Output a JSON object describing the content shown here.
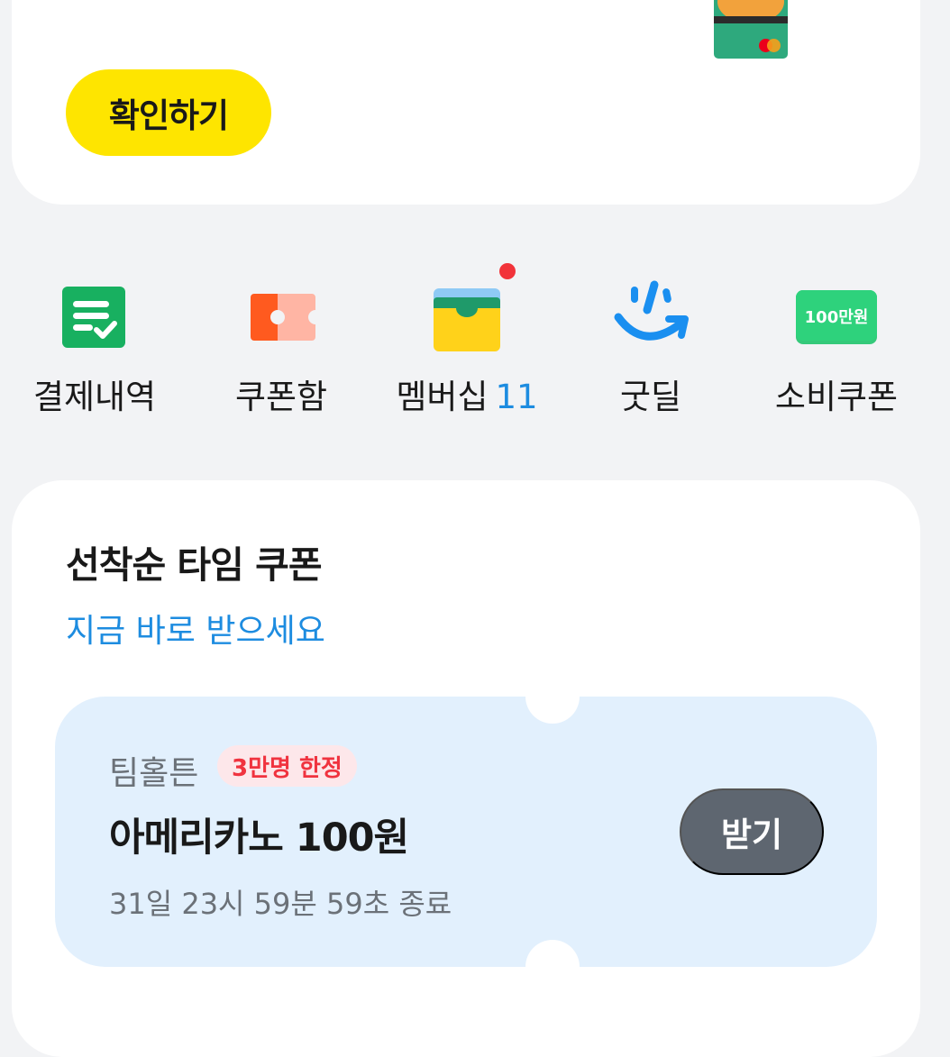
{
  "top_card": {
    "confirm_label": "확인하기"
  },
  "quick_menu": {
    "items": [
      {
        "label": "결제내역",
        "icon": "receipt-check-icon"
      },
      {
        "label": "쿠폰함",
        "icon": "ticket-icon"
      },
      {
        "label": "멤버십",
        "count": "11",
        "icon": "wallet-icon",
        "has_new_dot": true
      },
      {
        "label": "굿딜",
        "icon": "smile-arrow-icon"
      },
      {
        "label": "소비쿠폰",
        "icon": "voucher-100man-icon",
        "icon_text": "100만원"
      }
    ]
  },
  "coupon_section": {
    "title": "선착순 타임 쿠폰",
    "subtitle": "지금 바로 받으세요",
    "coupon": {
      "brand": "팀홀튼",
      "limit_badge": "3만명 한정",
      "title": "아메리카노 100원",
      "end_time": "31일 23시 59분 59초 종료",
      "get_label": "받기"
    }
  },
  "colors": {
    "background": "#f2f3f5",
    "accent_yellow": "#fee500",
    "accent_blue": "#1d8ce0",
    "badge_red": "#f0333f",
    "ticket_bg": "#e2f0fd",
    "button_gray": "#5e6670"
  }
}
